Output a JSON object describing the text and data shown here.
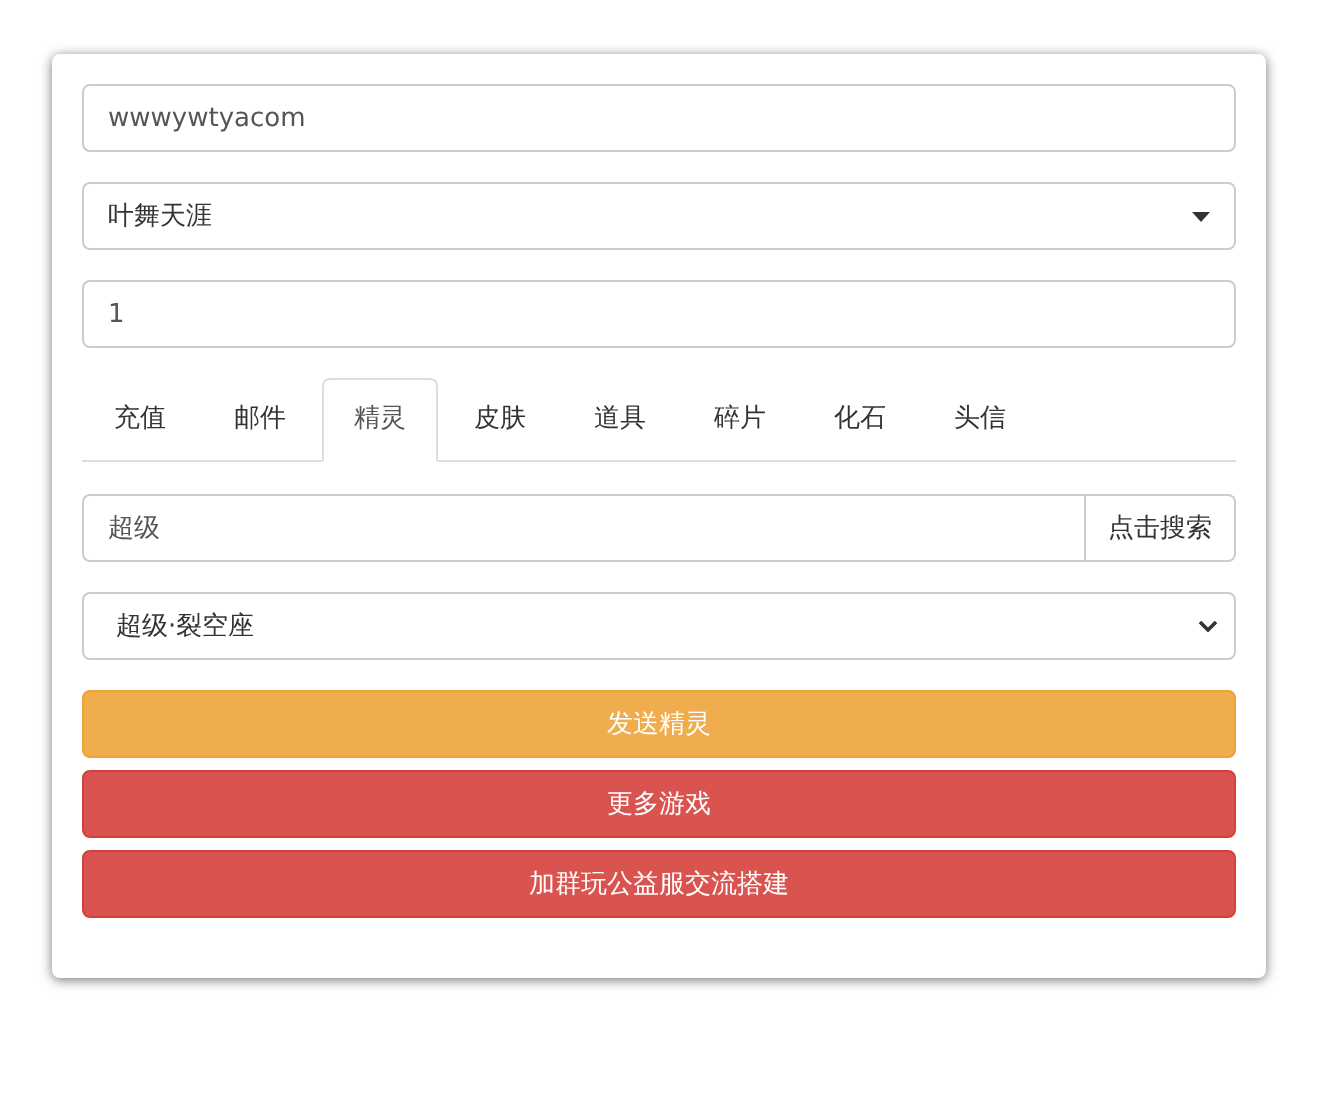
{
  "account": {
    "value": "wwwywtyacom"
  },
  "server": {
    "value": "叶舞天涯"
  },
  "quantity": {
    "value": "1"
  },
  "tabs": [
    {
      "label": "充值",
      "selected": false
    },
    {
      "label": "邮件",
      "selected": false
    },
    {
      "label": "精灵",
      "selected": true
    },
    {
      "label": "皮肤",
      "selected": false
    },
    {
      "label": "道具",
      "selected": false
    },
    {
      "label": "碎片",
      "selected": false
    },
    {
      "label": "化石",
      "selected": false
    },
    {
      "label": "头信",
      "selected": false
    }
  ],
  "search": {
    "value": "超级",
    "button": "点击搜索"
  },
  "item_select": {
    "value": "超级·裂空座"
  },
  "buttons": [
    {
      "label": "发送精灵",
      "kind": "warning"
    },
    {
      "label": "更多游戏",
      "kind": "danger"
    },
    {
      "label": "加群玩公益服交流搭建",
      "kind": "danger"
    }
  ]
}
